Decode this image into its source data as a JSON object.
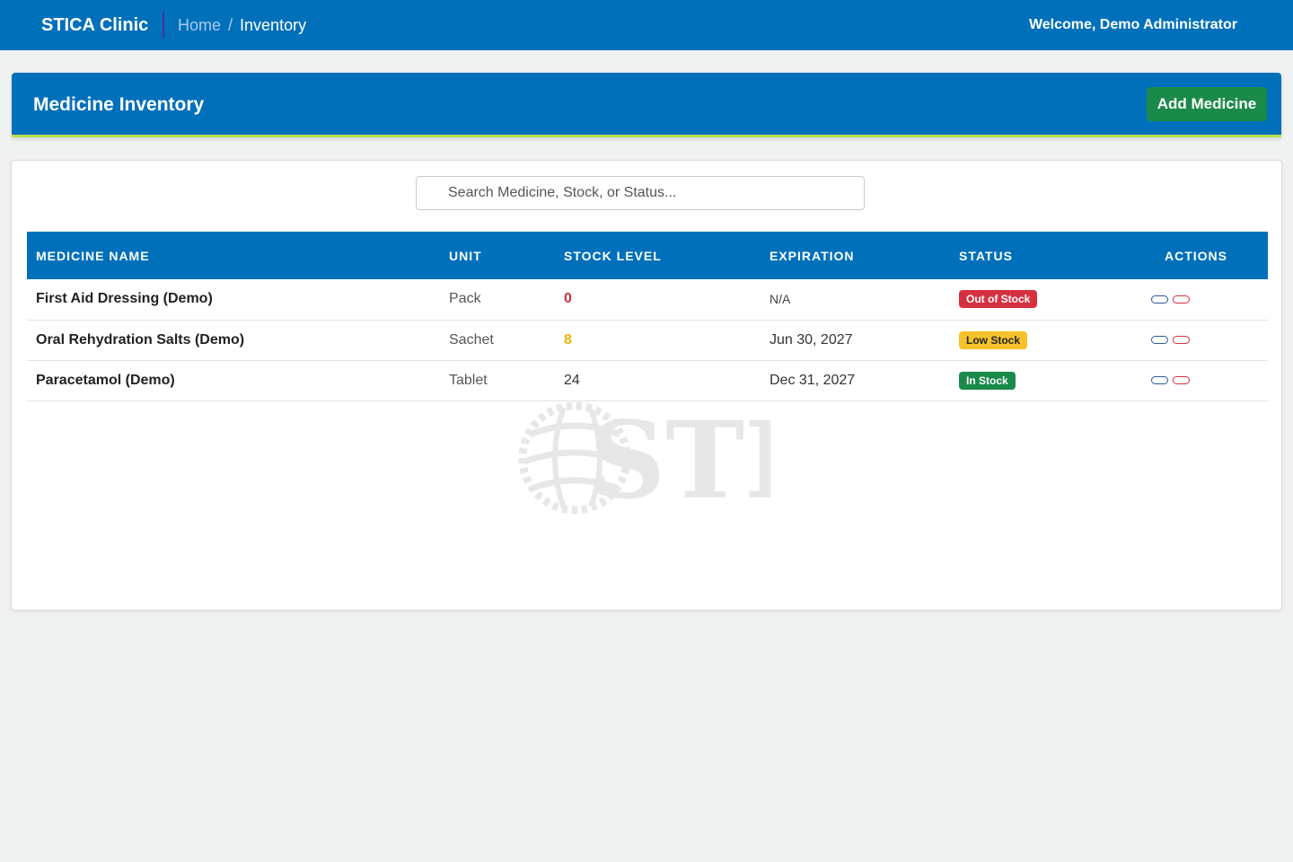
{
  "navbar": {
    "brand": "STICA Clinic",
    "breadcrumb": {
      "home": "Home",
      "separator": "/",
      "current": "Inventory"
    },
    "welcome": "Welcome, Demo Administrator"
  },
  "header": {
    "title": "Medicine Inventory",
    "add_button": "Add Medicine"
  },
  "search": {
    "placeholder": "Search Medicine, Stock, or Status...",
    "value": ""
  },
  "table": {
    "columns": [
      "MEDICINE NAME",
      "UNIT",
      "STOCK LEVEL",
      "EXPIRATION",
      "STATUS",
      "ACTIONS"
    ],
    "rows": [
      {
        "name": "First Aid Dressing (Demo)",
        "unit": "Pack",
        "stock": "0",
        "expiration": "N/A",
        "status": "Out of Stock"
      },
      {
        "name": "Oral Rehydration Salts (Demo)",
        "unit": "Sachet",
        "stock": "8",
        "expiration": "Jun 30, 2027",
        "status": "Low Stock"
      },
      {
        "name": "Paracetamol (Demo)",
        "unit": "Tablet",
        "stock": "24",
        "expiration": "Dec 31, 2027",
        "status": "In Stock"
      }
    ]
  },
  "watermark": {
    "text": "STI"
  },
  "colors": {
    "primary": "#0070bb",
    "success": "#1a8a4a",
    "danger": "#d63040",
    "warning": "#f6c22b",
    "accent_line": "#b8e04a",
    "background": "#f0f1f1"
  }
}
